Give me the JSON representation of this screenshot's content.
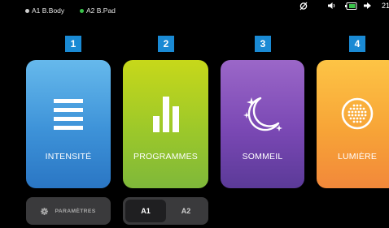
{
  "status": {
    "devices": [
      {
        "label": "A1 B.Body",
        "color": "#cfcfcf"
      },
      {
        "label": "A2 B.Pad",
        "color": "#3ac24a"
      }
    ],
    "icons": [
      "bluetooth-off-icon",
      "volume-icon",
      "battery-icon",
      "arrow-icon"
    ],
    "time": "21"
  },
  "menu": {
    "items": [
      {
        "number": "1",
        "label": "INTENSITÉ",
        "icon": "intensity-bars-icon"
      },
      {
        "number": "2",
        "label": "PROGRAMMES",
        "icon": "programs-chart-icon"
      },
      {
        "number": "3",
        "label": "SOMMEIL",
        "icon": "moon-stars-icon"
      },
      {
        "number": "4",
        "label": "LUMIÈRE",
        "icon": "light-dots-icon"
      }
    ]
  },
  "bottom": {
    "settings_label": "PARAMÈTRES",
    "segments": [
      {
        "label": "A1",
        "selected": true
      },
      {
        "label": "A2",
        "selected": false
      }
    ]
  },
  "colors": {
    "badge": "#1a8ad4",
    "intensity": "#3d92d8",
    "programs": "#9cc82a",
    "sleep": "#7a48b4",
    "light": "#f7a437"
  }
}
